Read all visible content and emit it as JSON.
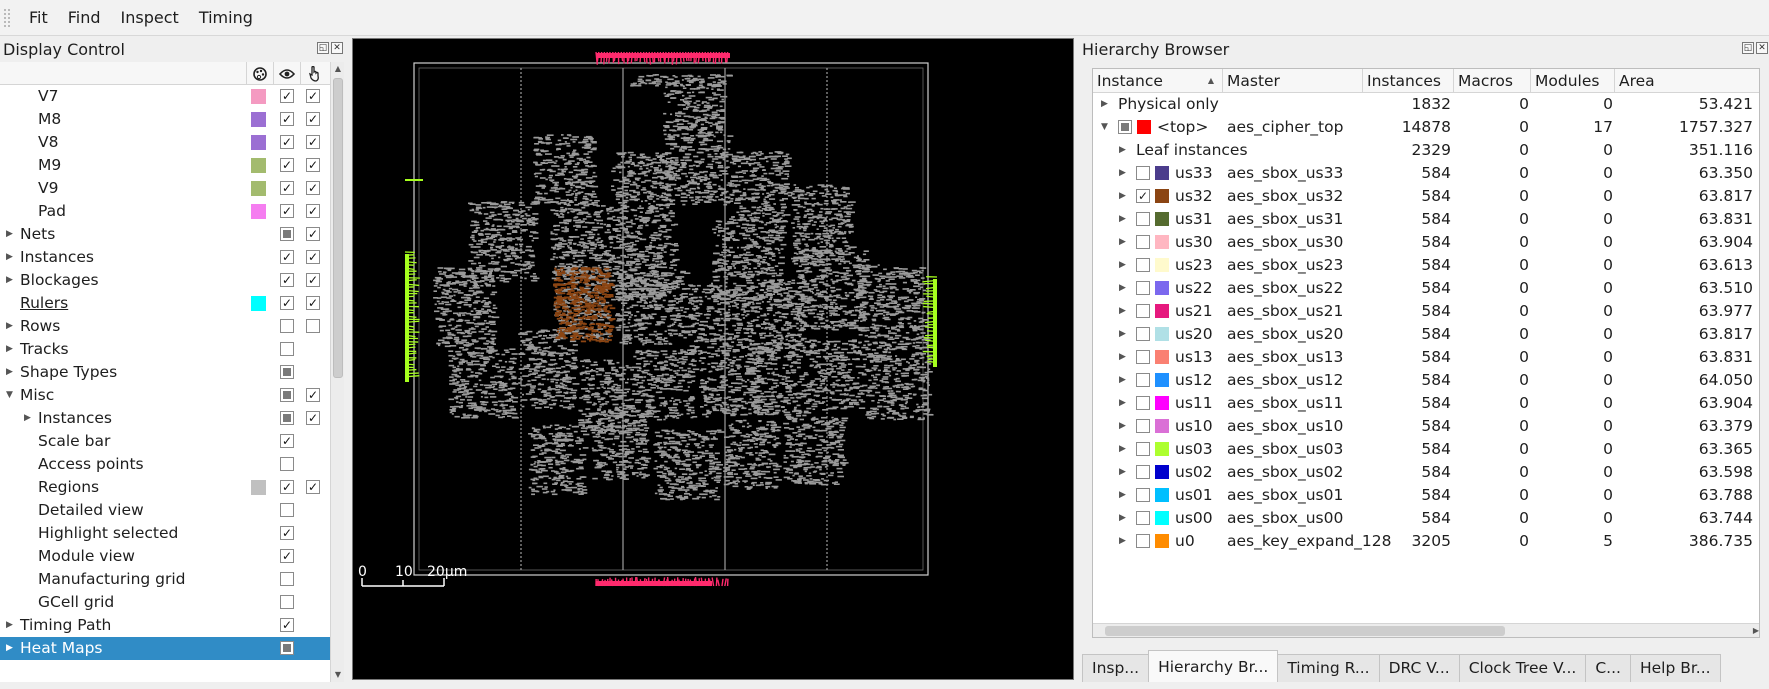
{
  "menu": [
    "Fit",
    "Find",
    "Inspect",
    "Timing"
  ],
  "display_control": {
    "title": "Display Control",
    "header_icons": [
      "palette-icon",
      "eye-icon",
      "select-pointer-icon"
    ],
    "rows": [
      {
        "label": "V7",
        "indent": 2,
        "arrow": "",
        "swatch": "#f49ac1",
        "c1": "checked",
        "c2": "checked"
      },
      {
        "label": "M8",
        "indent": 2,
        "arrow": "",
        "swatch": "#9b6fd3",
        "c1": "checked",
        "c2": "checked"
      },
      {
        "label": "V8",
        "indent": 2,
        "arrow": "",
        "swatch": "#9b6fd3",
        "c1": "checked",
        "c2": "checked"
      },
      {
        "label": "M9",
        "indent": 2,
        "arrow": "",
        "swatch": "#a3bb6e",
        "c1": "checked",
        "c2": "checked"
      },
      {
        "label": "V9",
        "indent": 2,
        "arrow": "",
        "swatch": "#a3bb6e",
        "c1": "checked",
        "c2": "checked"
      },
      {
        "label": "Pad",
        "indent": 2,
        "arrow": "",
        "swatch": "#f57df0",
        "c1": "checked",
        "c2": "checked"
      },
      {
        "label": "Nets",
        "indent": 1,
        "arrow": "collapsed",
        "swatch": "",
        "c1": "partial",
        "c2": "checked"
      },
      {
        "label": "Instances",
        "indent": 1,
        "arrow": "collapsed",
        "swatch": "",
        "c1": "checked",
        "c2": "checked"
      },
      {
        "label": "Blockages",
        "indent": 1,
        "arrow": "collapsed",
        "swatch": "",
        "c1": "checked",
        "c2": "checked"
      },
      {
        "label": "Rulers",
        "indent": 1,
        "arrow": "",
        "swatch": "#00ffff",
        "c1": "checked",
        "c2": "checked",
        "underline": true
      },
      {
        "label": "Rows",
        "indent": 1,
        "arrow": "collapsed",
        "swatch": "",
        "c1": "unchecked",
        "c2": "unchecked"
      },
      {
        "label": "Tracks",
        "indent": 1,
        "arrow": "collapsed",
        "swatch": "",
        "c1": "unchecked",
        "c2": "none"
      },
      {
        "label": "Shape Types",
        "indent": 1,
        "arrow": "collapsed",
        "swatch": "",
        "c1": "partial",
        "c2": "none"
      },
      {
        "label": "Misc",
        "indent": 1,
        "arrow": "expanded",
        "swatch": "",
        "c1": "partial",
        "c2": "checked"
      },
      {
        "label": "Instances",
        "indent": 2,
        "arrow": "collapsed",
        "swatch": "",
        "c1": "partial",
        "c2": "checked"
      },
      {
        "label": "Scale bar",
        "indent": 2,
        "arrow": "",
        "swatch": "",
        "c1": "checked",
        "c2": "none"
      },
      {
        "label": "Access points",
        "indent": 2,
        "arrow": "",
        "swatch": "",
        "c1": "unchecked",
        "c2": "none"
      },
      {
        "label": "Regions",
        "indent": 2,
        "arrow": "",
        "swatch": "#c0c0c0",
        "c1": "checked",
        "c2": "checked"
      },
      {
        "label": "Detailed view",
        "indent": 2,
        "arrow": "",
        "swatch": "",
        "c1": "unchecked",
        "c2": "none"
      },
      {
        "label": "Highlight selected",
        "indent": 2,
        "arrow": "",
        "swatch": "",
        "c1": "checked",
        "c2": "none"
      },
      {
        "label": "Module view",
        "indent": 2,
        "arrow": "",
        "swatch": "",
        "c1": "checked",
        "c2": "none"
      },
      {
        "label": "Manufacturing grid",
        "indent": 2,
        "arrow": "",
        "swatch": "",
        "c1": "unchecked",
        "c2": "none"
      },
      {
        "label": "GCell grid",
        "indent": 2,
        "arrow": "",
        "swatch": "",
        "c1": "unchecked",
        "c2": "none"
      },
      {
        "label": "Timing Path",
        "indent": 1,
        "arrow": "collapsed",
        "swatch": "",
        "c1": "checked",
        "c2": "none"
      },
      {
        "label": "Heat Maps",
        "indent": 1,
        "arrow": "collapsed",
        "swatch": "",
        "c1": "partial",
        "c2": "none",
        "selected": true
      }
    ]
  },
  "layout_view": {
    "scale_bar": {
      "tick_0": "0",
      "tick_1": "10",
      "tick_2": "20μm"
    },
    "highlight_color": "#8b4513",
    "cell_color": "#9a9a9a",
    "pin_color_edge": "#a6ff1e",
    "pin_color_io": "#ff2a6d"
  },
  "hierarchy": {
    "title": "Hierarchy Browser",
    "columns": [
      "Instance",
      "Master",
      "Instances",
      "Macros",
      "Modules",
      "Area"
    ],
    "rows": [
      {
        "level": 0,
        "arrow": "collapsed",
        "checkbox": "none",
        "swatch": "",
        "instance": "Physical only",
        "master": "",
        "instances": "1832",
        "macros": "0",
        "modules": "0",
        "area": "53.421"
      },
      {
        "level": 0,
        "arrow": "expanded",
        "checkbox": "partial",
        "swatch": "#ff0000",
        "instance": "<top>",
        "master": "aes_cipher_top",
        "instances": "14878",
        "macros": "0",
        "modules": "17",
        "area": "1757.327"
      },
      {
        "level": 1,
        "arrow": "collapsed",
        "checkbox": "none",
        "swatch": "",
        "instance": "Leaf instances",
        "master": "",
        "instances": "2329",
        "macros": "0",
        "modules": "0",
        "area": "351.116"
      },
      {
        "level": 1,
        "arrow": "collapsed",
        "checkbox": "unchecked",
        "swatch": "#4b3c8c",
        "instance": "us33",
        "master": "aes_sbox_us33",
        "instances": "584",
        "macros": "0",
        "modules": "0",
        "area": "63.350"
      },
      {
        "level": 1,
        "arrow": "collapsed",
        "checkbox": "checked",
        "swatch": "#8b4513",
        "instance": "us32",
        "master": "aes_sbox_us32",
        "instances": "584",
        "macros": "0",
        "modules": "0",
        "area": "63.817"
      },
      {
        "level": 1,
        "arrow": "collapsed",
        "checkbox": "unchecked",
        "swatch": "#556b2f",
        "instance": "us31",
        "master": "aes_sbox_us31",
        "instances": "584",
        "macros": "0",
        "modules": "0",
        "area": "63.831"
      },
      {
        "level": 1,
        "arrow": "collapsed",
        "checkbox": "unchecked",
        "swatch": "#ffb6c1",
        "instance": "us30",
        "master": "aes_sbox_us30",
        "instances": "584",
        "macros": "0",
        "modules": "0",
        "area": "63.904"
      },
      {
        "level": 1,
        "arrow": "collapsed",
        "checkbox": "unchecked",
        "swatch": "#fffacd",
        "instance": "us23",
        "master": "aes_sbox_us23",
        "instances": "584",
        "macros": "0",
        "modules": "0",
        "area": "63.613"
      },
      {
        "level": 1,
        "arrow": "collapsed",
        "checkbox": "unchecked",
        "swatch": "#7b68ee",
        "instance": "us22",
        "master": "aes_sbox_us22",
        "instances": "584",
        "macros": "0",
        "modules": "0",
        "area": "63.510"
      },
      {
        "level": 1,
        "arrow": "collapsed",
        "checkbox": "unchecked",
        "swatch": "#e6197e",
        "instance": "us21",
        "master": "aes_sbox_us21",
        "instances": "584",
        "macros": "0",
        "modules": "0",
        "area": "63.977"
      },
      {
        "level": 1,
        "arrow": "collapsed",
        "checkbox": "unchecked",
        "swatch": "#b0e0e6",
        "instance": "us20",
        "master": "aes_sbox_us20",
        "instances": "584",
        "macros": "0",
        "modules": "0",
        "area": "63.817"
      },
      {
        "level": 1,
        "arrow": "collapsed",
        "checkbox": "unchecked",
        "swatch": "#fa8072",
        "instance": "us13",
        "master": "aes_sbox_us13",
        "instances": "584",
        "macros": "0",
        "modules": "0",
        "area": "63.831"
      },
      {
        "level": 1,
        "arrow": "collapsed",
        "checkbox": "unchecked",
        "swatch": "#1e90ff",
        "instance": "us12",
        "master": "aes_sbox_us12",
        "instances": "584",
        "macros": "0",
        "modules": "0",
        "area": "64.050"
      },
      {
        "level": 1,
        "arrow": "collapsed",
        "checkbox": "unchecked",
        "swatch": "#ff00ff",
        "instance": "us11",
        "master": "aes_sbox_us11",
        "instances": "584",
        "macros": "0",
        "modules": "0",
        "area": "63.904"
      },
      {
        "level": 1,
        "arrow": "collapsed",
        "checkbox": "unchecked",
        "swatch": "#da70d6",
        "instance": "us10",
        "master": "aes_sbox_us10",
        "instances": "584",
        "macros": "0",
        "modules": "0",
        "area": "63.379"
      },
      {
        "level": 1,
        "arrow": "collapsed",
        "checkbox": "unchecked",
        "swatch": "#adff2f",
        "instance": "us03",
        "master": "aes_sbox_us03",
        "instances": "584",
        "macros": "0",
        "modules": "0",
        "area": "63.365"
      },
      {
        "level": 1,
        "arrow": "collapsed",
        "checkbox": "unchecked",
        "swatch": "#0000cd",
        "instance": "us02",
        "master": "aes_sbox_us02",
        "instances": "584",
        "macros": "0",
        "modules": "0",
        "area": "63.598"
      },
      {
        "level": 1,
        "arrow": "collapsed",
        "checkbox": "unchecked",
        "swatch": "#00bfff",
        "instance": "us01",
        "master": "aes_sbox_us01",
        "instances": "584",
        "macros": "0",
        "modules": "0",
        "area": "63.788"
      },
      {
        "level": 1,
        "arrow": "collapsed",
        "checkbox": "unchecked",
        "swatch": "#00ffff",
        "instance": "us00",
        "master": "aes_sbox_us00",
        "instances": "584",
        "macros": "0",
        "modules": "0",
        "area": "63.744"
      },
      {
        "level": 1,
        "arrow": "collapsed",
        "checkbox": "unchecked",
        "swatch": "#ff8c00",
        "instance": "u0",
        "master": "aes_key_expand_128",
        "instances": "3205",
        "macros": "0",
        "modules": "5",
        "area": "386.735"
      }
    ]
  },
  "tabs": [
    {
      "label": "Insp...",
      "active": false
    },
    {
      "label": "Hierarchy Br...",
      "active": true
    },
    {
      "label": "Timing R...",
      "active": false
    },
    {
      "label": "DRC V...",
      "active": false
    },
    {
      "label": "Clock Tree V...",
      "active": false
    },
    {
      "label": "C...",
      "active": false
    },
    {
      "label": "Help Br...",
      "active": false
    }
  ]
}
